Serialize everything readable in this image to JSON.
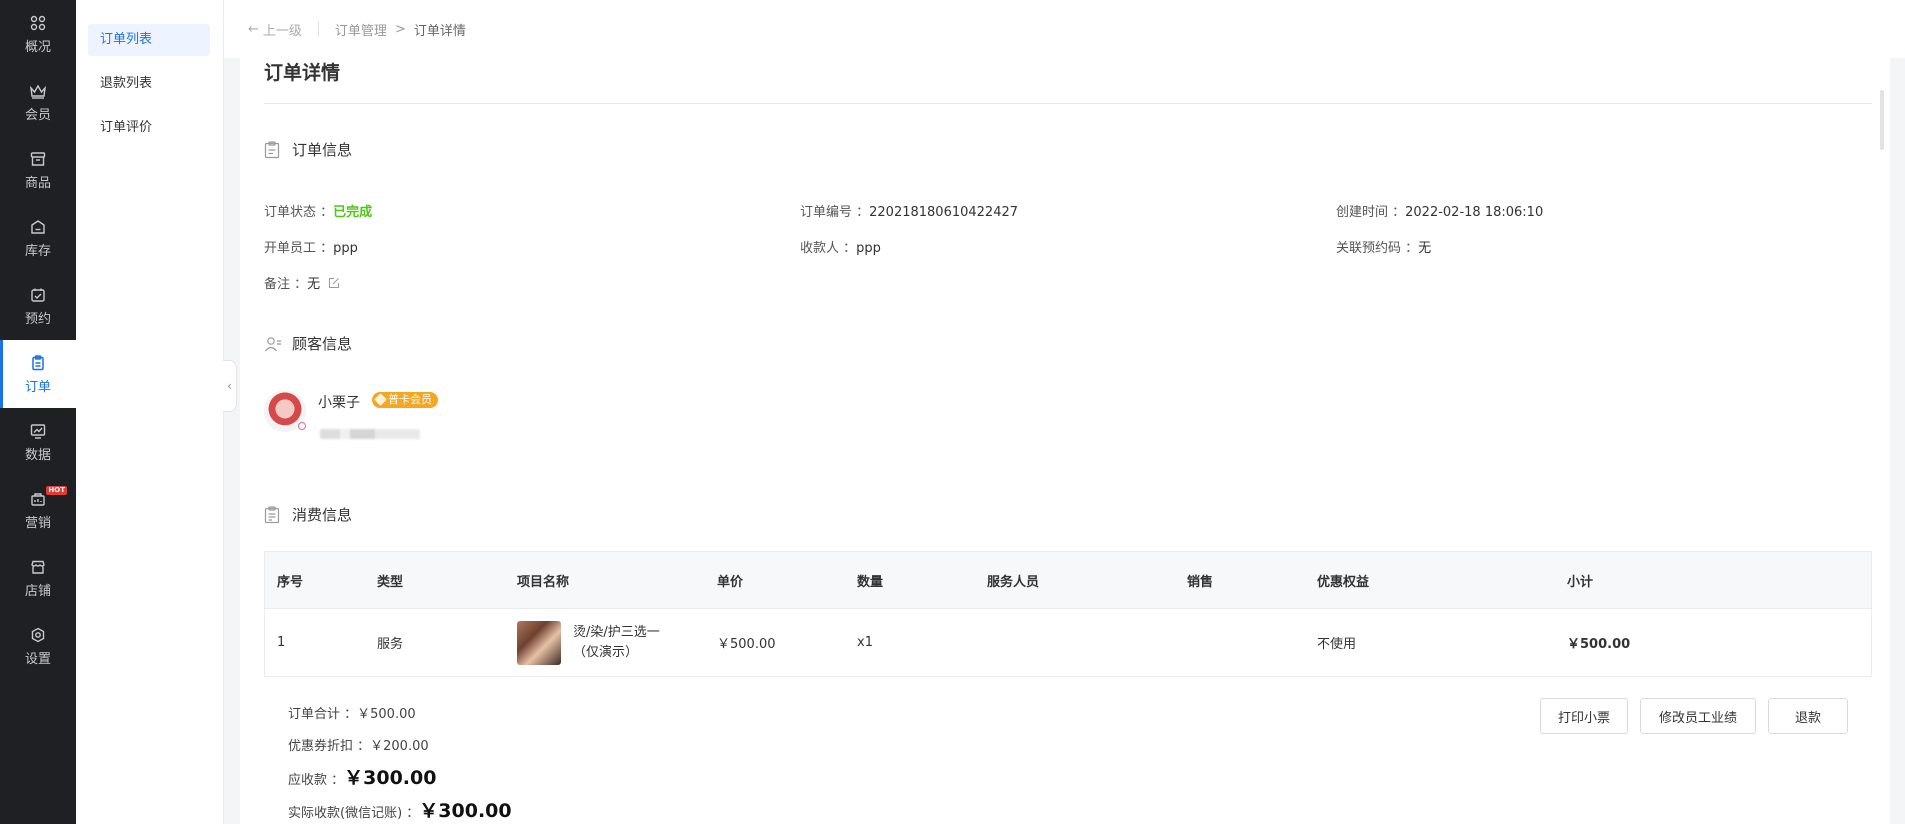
{
  "nav": {
    "items": [
      {
        "label": "概况",
        "icon": "grid-icon"
      },
      {
        "label": "会员",
        "icon": "crown-icon"
      },
      {
        "label": "商品",
        "icon": "box-icon"
      },
      {
        "label": "库存",
        "icon": "warehouse-icon"
      },
      {
        "label": "预约",
        "icon": "calendar-check-icon"
      },
      {
        "label": "订单",
        "icon": "clipboard-icon",
        "active": true
      },
      {
        "label": "数据",
        "icon": "chart-icon"
      },
      {
        "label": "营销",
        "icon": "marketing-icon",
        "badge": "HOT"
      },
      {
        "label": "店铺",
        "icon": "store-icon"
      },
      {
        "label": "设置",
        "icon": "settings-icon"
      }
    ]
  },
  "submenu": {
    "items": [
      {
        "label": "订单列表",
        "active": true
      },
      {
        "label": "退款列表"
      },
      {
        "label": "订单评价"
      }
    ]
  },
  "topbar": {
    "back_label": "上一级",
    "breadcrumb": [
      "订单管理",
      "订单详情"
    ],
    "crumb_sep": ">"
  },
  "page": {
    "title": "订单详情"
  },
  "order_info": {
    "section_title": "订单信息",
    "status_label": "订单状态 ：",
    "status_value": "已完成",
    "number_label": "订单编号 ：",
    "number_value": "220218180610422427",
    "created_label": "创建时间 ：",
    "created_value": "2022-02-18 18:06:10",
    "staff_label": "开单员工 ：",
    "staff_value": "ppp",
    "cashier_label": "收款人 ：",
    "cashier_value": "ppp",
    "booking_label": "关联预约码 ：",
    "booking_value": "无",
    "remark_label": "备注 ：",
    "remark_value": "无",
    "status_color": "#52c41a"
  },
  "customer": {
    "section_title": "顾客信息",
    "name": "小栗子",
    "badge": "普卡会员",
    "badge_color": "#f5a623"
  },
  "consumption": {
    "section_title": "消费信息",
    "columns": [
      "序号",
      "类型",
      "项目名称",
      "单价",
      "数量",
      "服务人员",
      "销售",
      "优惠权益",
      "小计"
    ],
    "rows": [
      {
        "index": "1",
        "type": "服务",
        "name": "烫/染/护三选一（仅演示）",
        "price": "￥500.00",
        "qty": "x1",
        "staff": "",
        "sales": "",
        "discount": "不使用",
        "subtotal": "￥500.00"
      }
    ]
  },
  "summary": {
    "total_label": "订单合计 ：",
    "total_value": "￥500.00",
    "coupon_label": "优惠券折扣 ：",
    "coupon_value": "￥200.00",
    "receivable_label": "应收款 ：",
    "receivable_value": "￥300.00",
    "actual_label": "实际收款(微信记账) ：",
    "actual_value": "￥300.00"
  },
  "actions": {
    "print_label": "打印小票",
    "edit_perf_label": "修改员工业绩",
    "refund_label": "退款"
  },
  "colors": {
    "accent": "#1a73e8",
    "nav_bg": "#1f2023"
  }
}
